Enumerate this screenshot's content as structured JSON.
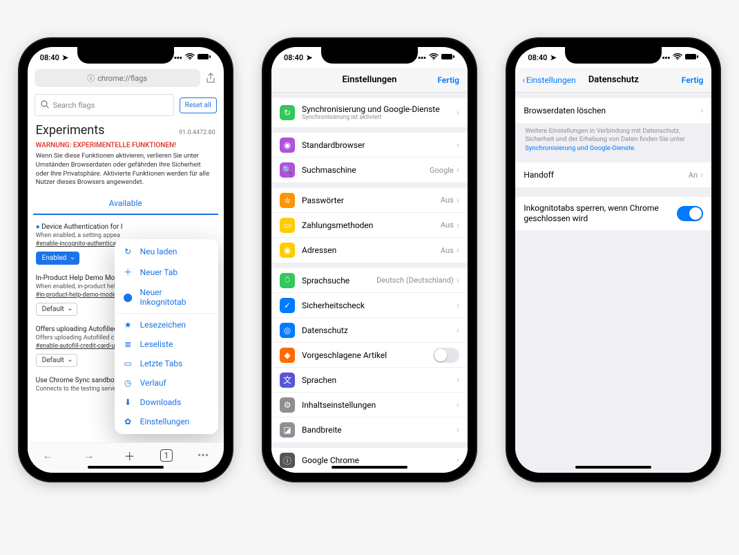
{
  "status": {
    "time": "08:40",
    "location_icon": "location-icon"
  },
  "phone1": {
    "url": "chrome://flags",
    "search_placeholder": "Search flags",
    "reset_all": "Reset all",
    "experiments_title": "Experiments",
    "version": "91.0.4472.80",
    "warning": "WARNUNG: EXPERIMENTELLE FUNKTIONEN!",
    "description": "Wenn Sie diese Funktionen aktivieren, verlieren Sie unter Umständen Browserdaten oder gefährden Ihre Sicherheit oder Ihre Privatsphäre. Aktivierte Funktionen werden für alle Nutzer dieses Browsers angewendet.",
    "tab_available": "Available",
    "flags": [
      {
        "title": "Device Authentication for I",
        "sub": "When enabled, a setting appea",
        "link": "#enable-incognito-authentica",
        "select": "Enabled",
        "style": "enabled",
        "dot": true
      },
      {
        "title": "In-Product Help Demo Mode",
        "sub": "When enabled, in-product help",
        "link": "#in-product-help-demo-mode",
        "select": "Default",
        "style": "",
        "dot": false
      },
      {
        "title": "Offers uploading Autofilled cr",
        "sub": "Offers uploading Autofilled cred",
        "link": "#enable-autofill-credit-card-u",
        "select": "Default",
        "style": "",
        "dot": false
      },
      {
        "title": "Use Chrome Sync sandbox",
        "sub": "Connects to the testing server f",
        "link": "",
        "select": "",
        "style": "",
        "dot": false
      }
    ],
    "menu": [
      {
        "icon": "reload-icon",
        "glyph": "↻",
        "label": "Neu laden"
      },
      {
        "icon": "plus-icon",
        "glyph": "＋",
        "label": "Neuer Tab"
      },
      {
        "icon": "incognito-icon",
        "glyph": "⬤",
        "label": "Neuer Inkognitotab"
      },
      {
        "sep": true
      },
      {
        "icon": "star-icon",
        "glyph": "★",
        "label": "Lesezeichen"
      },
      {
        "icon": "list-icon",
        "glyph": "≣",
        "label": "Leseliste"
      },
      {
        "icon": "recent-tabs-icon",
        "glyph": "▭",
        "label": "Letzte Tabs"
      },
      {
        "icon": "history-icon",
        "glyph": "◷",
        "label": "Verlauf"
      },
      {
        "icon": "download-icon",
        "glyph": "⬇",
        "label": "Downloads"
      },
      {
        "icon": "settings-icon",
        "glyph": "✿",
        "label": "Einstellungen"
      }
    ]
  },
  "phone2": {
    "title": "Einstellungen",
    "done": "Fertig",
    "groups": [
      {
        "rows": [
          {
            "iconColor": "#34c759",
            "iconGlyph": "↻",
            "label": "Synchronisierung und Google-Dienste",
            "sub": "Synchronisierung ist aktiviert",
            "value": "",
            "tall": true
          }
        ]
      },
      {
        "rows": [
          {
            "iconColor": "#af52de",
            "iconGlyph": "◉",
            "label": "Standardbrowser",
            "value": ""
          },
          {
            "iconColor": "#af52de",
            "iconGlyph": "🔍",
            "label": "Suchmaschine",
            "value": "Google"
          }
        ]
      },
      {
        "rows": [
          {
            "iconColor": "#ff9500",
            "iconGlyph": "✮",
            "label": "Passwörter",
            "value": "Aus"
          },
          {
            "iconColor": "#ffcc00",
            "iconGlyph": "▭",
            "label": "Zahlungsmethoden",
            "value": "Aus"
          },
          {
            "iconColor": "#ffcc00",
            "iconGlyph": "◉",
            "label": "Adressen",
            "value": "Aus"
          }
        ]
      },
      {
        "rows": [
          {
            "iconColor": "#34c759",
            "iconGlyph": "⍥",
            "label": "Sprachsuche",
            "value": "Deutsch (Deutschland)"
          },
          {
            "iconColor": "#007aff",
            "iconGlyph": "✓",
            "label": "Sicherheitscheck",
            "value": ""
          },
          {
            "iconColor": "#007aff",
            "iconGlyph": "◎",
            "label": "Datenschutz",
            "value": ""
          },
          {
            "iconColor": "#ff6b00",
            "iconGlyph": "◆",
            "label": "Vorgeschlagene Artikel",
            "value": "",
            "toggle": "off"
          },
          {
            "iconColor": "#5856d6",
            "iconGlyph": "文",
            "label": "Sprachen",
            "value": ""
          },
          {
            "iconColor": "#8e8e93",
            "iconGlyph": "⚙",
            "label": "Inhaltseinstellungen",
            "value": ""
          },
          {
            "iconColor": "#8e8e93",
            "iconGlyph": "◪",
            "label": "Bandbreite",
            "value": ""
          }
        ]
      },
      {
        "rows": [
          {
            "iconColor": "#555",
            "iconGlyph": "ⓘ",
            "label": "Google Chrome",
            "value": ""
          }
        ]
      }
    ]
  },
  "phone3": {
    "back": "Einstellungen",
    "title": "Datenschutz",
    "done": "Fertig",
    "rows": {
      "clear": "Browserdaten löschen",
      "footer1": "Weitere Einstellungen in Verbindung mit Datenschutz, Sicherheit und der Erhebung von Daten finden Sie unter ",
      "footer_link": "Synchronisierung und Google-Dienste",
      "handoff_label": "Handoff",
      "handoff_value": "An",
      "lock_label": "Inkognitotabs sperren, wenn Chrome geschlossen wird"
    }
  }
}
